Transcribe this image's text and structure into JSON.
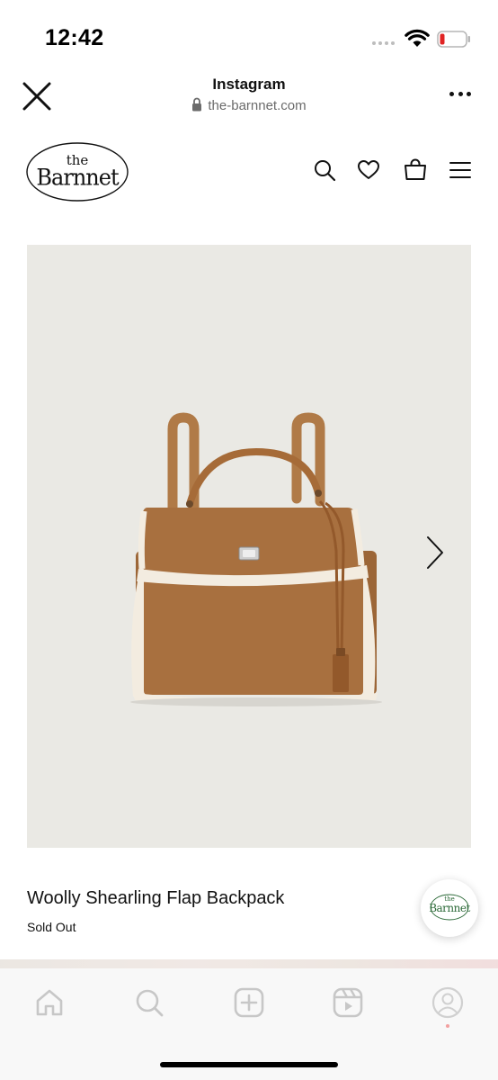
{
  "status_bar": {
    "time": "12:42",
    "battery_color": "#e02424"
  },
  "browser": {
    "title": "Instagram",
    "url": "the-barnnet.com",
    "close_icon": "close-icon",
    "more_icon": "more-horizontal-icon"
  },
  "site": {
    "logo_top": "the",
    "logo_bottom": "Barnnet",
    "nav_icons": [
      "search-icon",
      "heart-icon",
      "shopping-bag-icon",
      "menu-icon"
    ]
  },
  "product": {
    "name": "Woolly Shearling Flap Backpack",
    "status": "Sold Out",
    "image_background": "#eae9e4",
    "suede_color": "#a8703f",
    "shearling_color": "#f3ece0"
  },
  "chat": {
    "logo_top": "the",
    "logo_bottom": "Barnnet",
    "accent": "#2e6b3a"
  },
  "bottom_nav": {
    "items": [
      "home-icon",
      "search-icon",
      "create-icon",
      "reels-icon",
      "profile-icon"
    ]
  }
}
